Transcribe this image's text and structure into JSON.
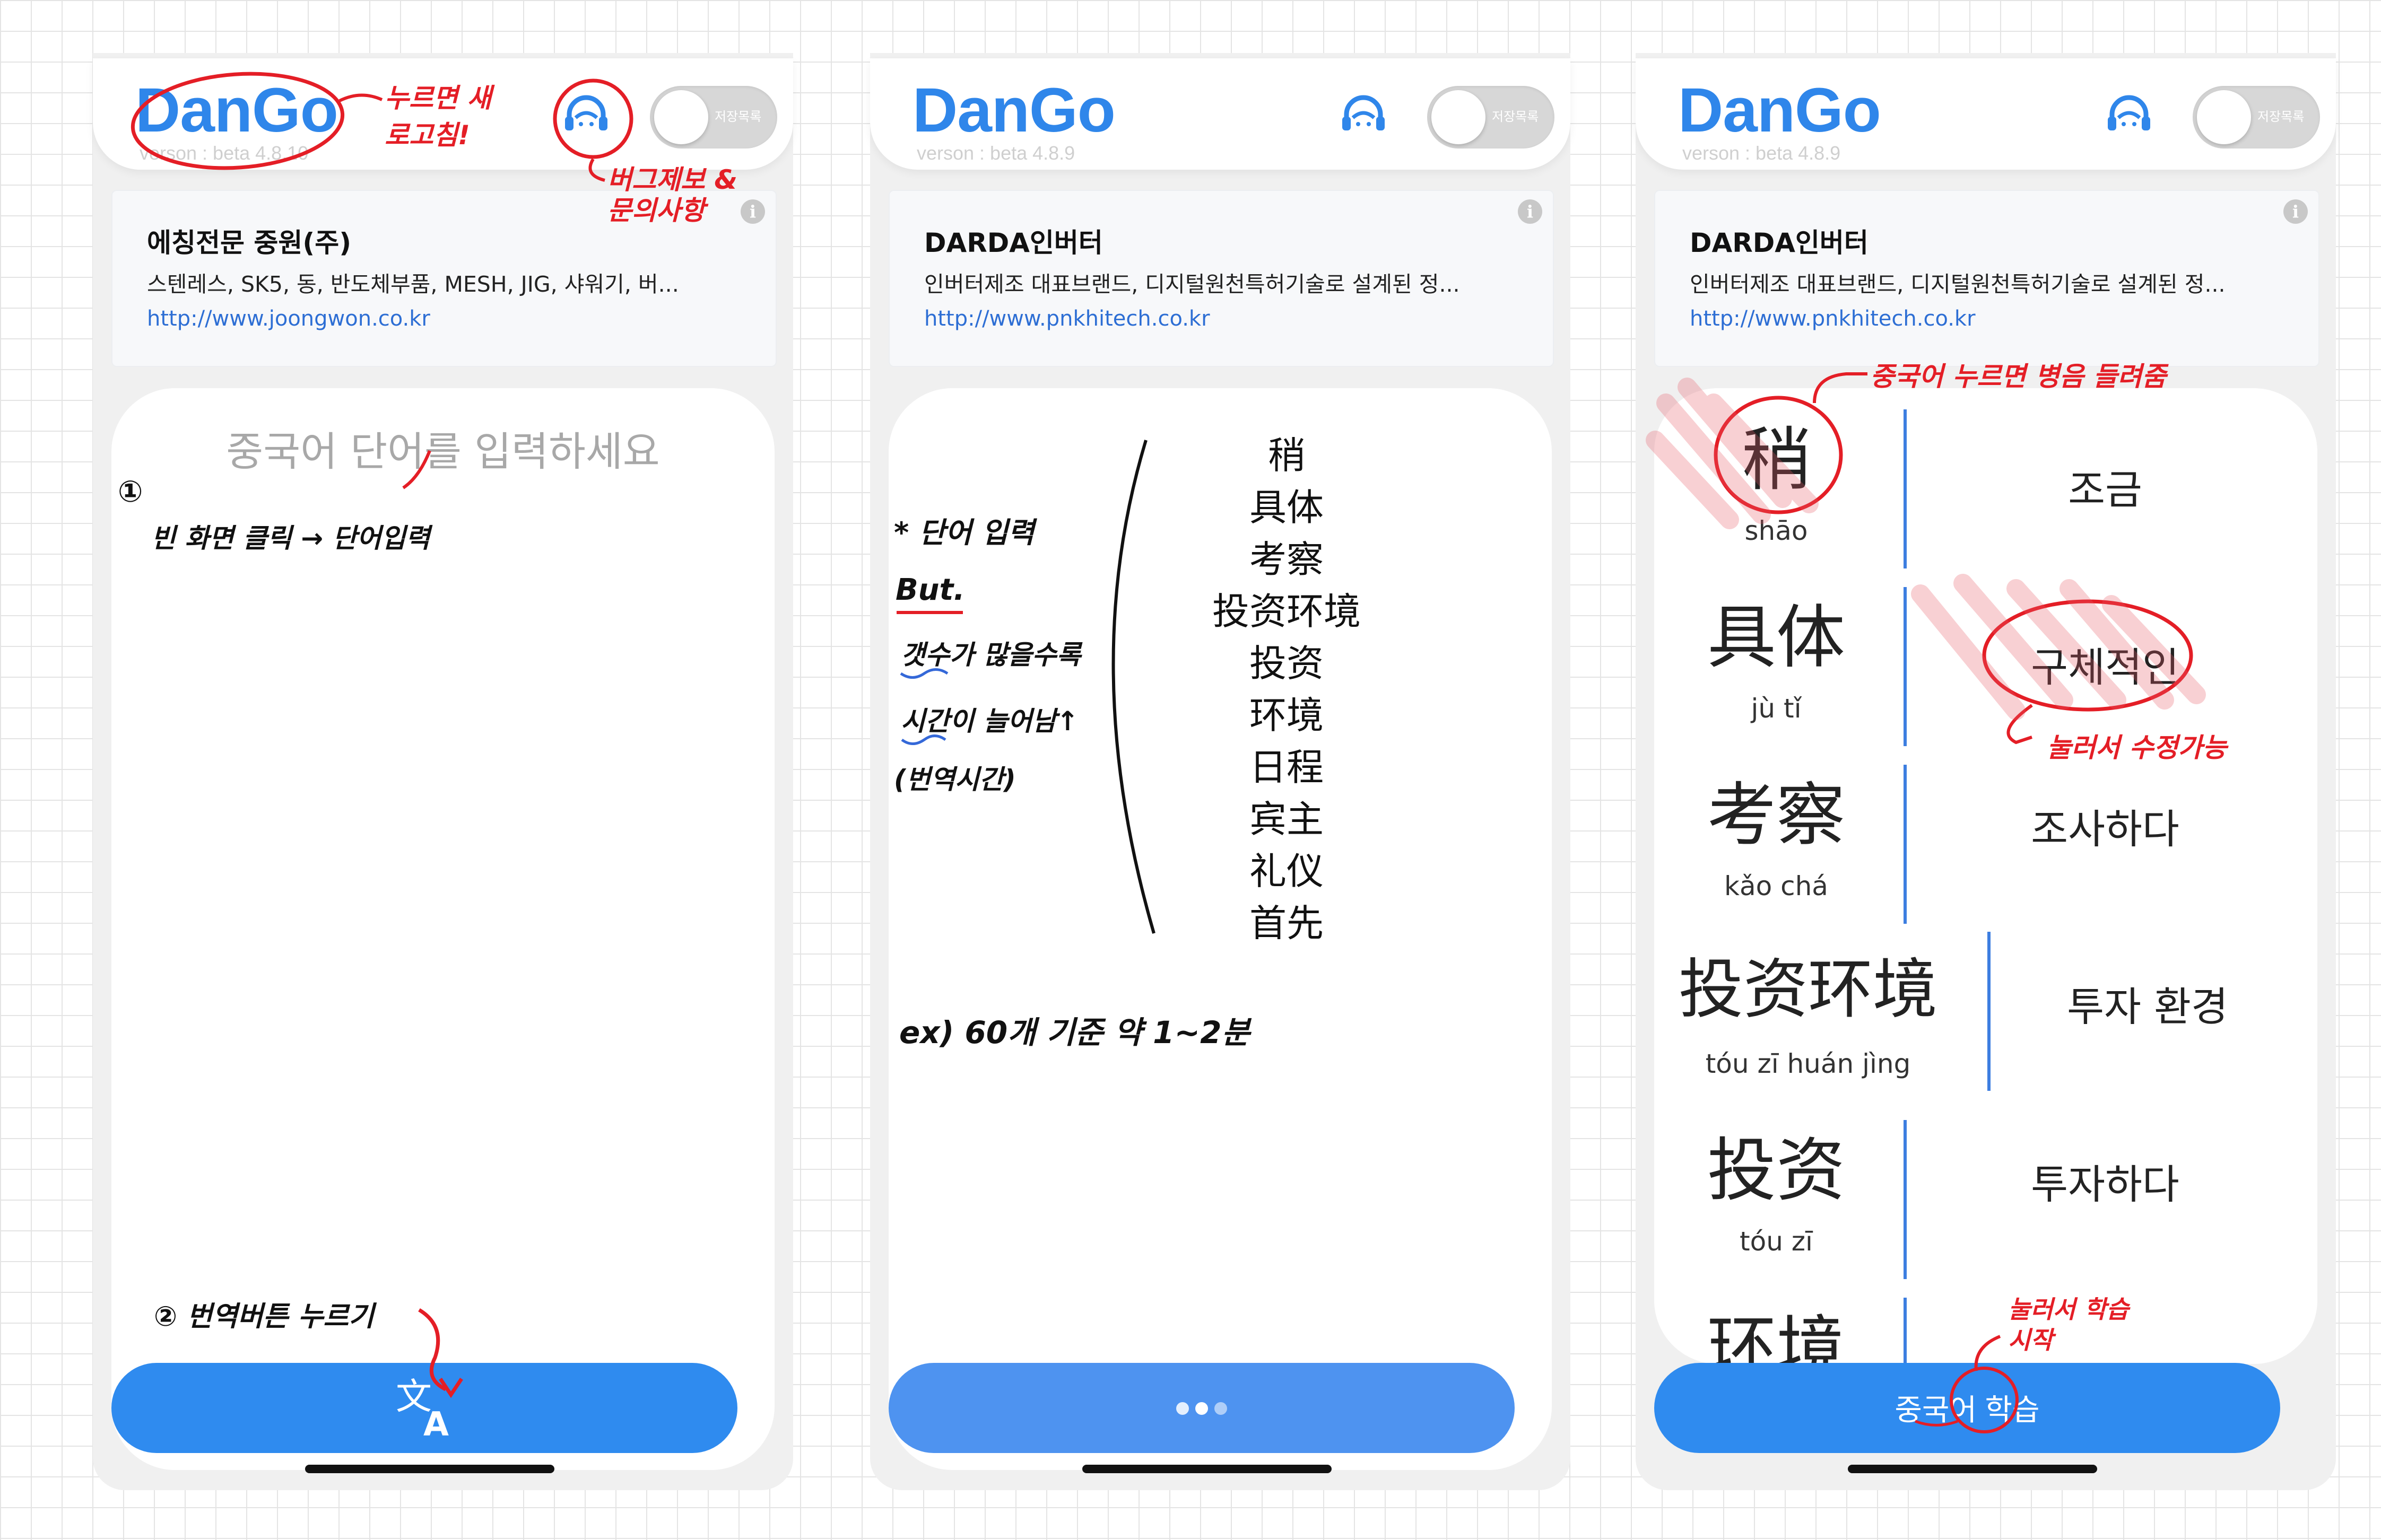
{
  "colors": {
    "brand": "#2f86ea",
    "button": "#2f8bef",
    "accent_line": "#3d7ee0",
    "annotation": "#e41e26"
  },
  "screens": [
    {
      "app_title": "DanGo",
      "version": "verson : beta 4.8.10",
      "toggle_label": "저장목록",
      "card": {
        "company": "에칭전문 중원(주)",
        "description": "스텐레스, SK5, 동, 반도체부품, MESH, JIG, 샤워기, 버...",
        "url": "http://www.joongwon.co.kr"
      },
      "placeholder": "중국어 단어를 입력하세요",
      "button_icon": "translate-icon"
    },
    {
      "app_title": "DanGo",
      "version": "verson : beta 4.8.9",
      "toggle_label": "저장목록",
      "card": {
        "company": "DARDA인버터",
        "description": "인버터제조 대표브랜드, 디지털원천특허기술로 설계된 정...",
        "url": "http://www.pnkhitech.co.kr"
      },
      "input_words": [
        "稍",
        "具体",
        "考察",
        "投资环境",
        "投资",
        "环境",
        "日程",
        "宾主",
        "礼仪",
        "首先"
      ],
      "button_icon": "loading-dots-icon"
    },
    {
      "app_title": "DanGo",
      "version": "verson : beta 4.8.9",
      "toggle_label": "저장목록",
      "card": {
        "company": "DARDA인버터",
        "description": "인버터제조 대표브랜드, 디지털원천특허기술로 설계된 정...",
        "url": "http://www.pnkhitech.co.kr"
      },
      "results": [
        {
          "hanzi": "稍",
          "pinyin": "shāo",
          "korean": "조금"
        },
        {
          "hanzi": "具体",
          "pinyin": "jù tǐ",
          "korean": "구체적인"
        },
        {
          "hanzi": "考察",
          "pinyin": "kǎo chá",
          "korean": "조사하다"
        },
        {
          "hanzi": "投资环境",
          "pinyin": "tóu zī huán jìng",
          "korean": "투자 환경"
        },
        {
          "hanzi": "投资",
          "pinyin": "tóu zī",
          "korean": "투자하다"
        },
        {
          "hanzi": "环境",
          "pinyin": "",
          "korean": ""
        }
      ],
      "study_button": "중국어 학습"
    }
  ],
  "annotations": {
    "s1_logo": "누르면 새로고침!",
    "s1_support": "버그제보 & 문의사항",
    "s1_step1_num": "①",
    "s1_step1": "빈 화면 클릭 → 단어입력",
    "s1_step2": "② 번역버튼 누르기",
    "s2_input": "* 단어 입력",
    "s2_but": "But.",
    "s2_more": "갯수가 많을수록",
    "s2_time": "시간이 늘어남↑",
    "s2_paren": "(번역시간)",
    "s2_example": "ex) 60개 기준 약 1~2분",
    "s3_pinyin": "중국어 누르면 병음 들려줌",
    "s3_edit": "눌러서 수정가능",
    "s3_study": "눌러서 학습시작"
  }
}
